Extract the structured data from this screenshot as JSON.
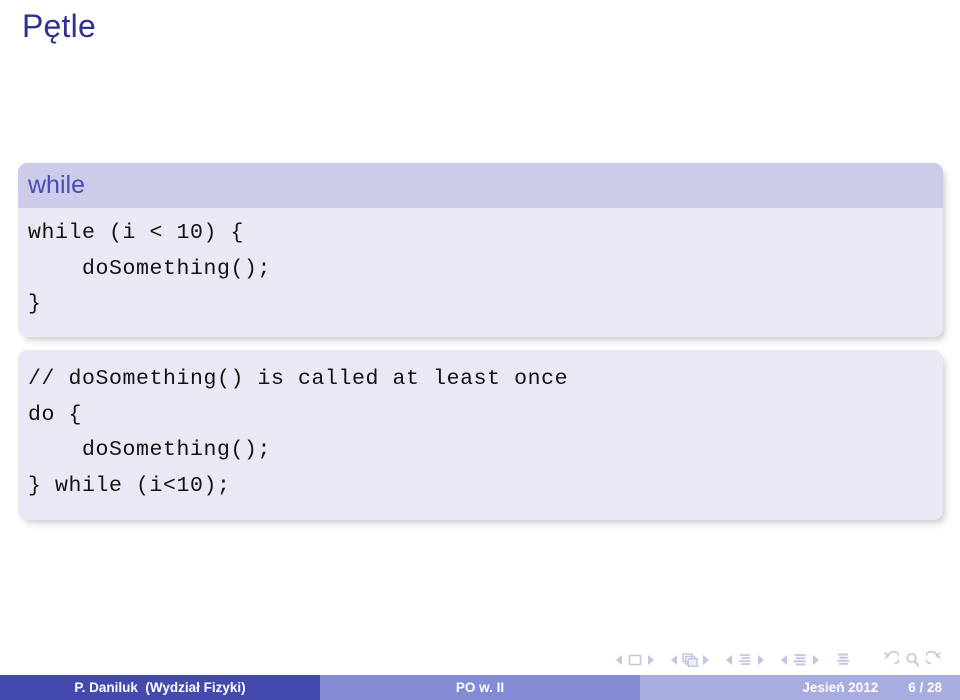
{
  "slide": {
    "title": "Pętle"
  },
  "blocks": [
    {
      "id": "while",
      "title": "while",
      "has_title": true,
      "code_lines": [
        "while (i < 10) {",
        "    doSomething();",
        "}"
      ]
    },
    {
      "id": "dowhile",
      "title": "",
      "has_title": false,
      "code_lines": [
        "// doSomething() is called at least once",
        "do {",
        "    doSomething();",
        "} while (i<10);"
      ]
    }
  ],
  "navigation": {
    "items": [
      {
        "name": "slide",
        "icon": "slide-icon"
      },
      {
        "name": "frame",
        "icon": "frame-icon"
      },
      {
        "name": "subsection",
        "icon": "subsection-icon"
      },
      {
        "name": "section",
        "icon": "section-icon"
      },
      {
        "name": "presentation",
        "icon": "presentation-icon"
      }
    ],
    "arrows": [
      {
        "name": "back",
        "icon": "back-arrow-icon"
      },
      {
        "name": "find",
        "icon": "search-icon"
      },
      {
        "name": "forward",
        "icon": "forward-arrow-icon"
      }
    ]
  },
  "footer": {
    "author": "P. Daniluk  (Wydział Fizyki)",
    "course": "PO w. II",
    "date": "Jesień 2012",
    "page": "6 / 28",
    "colors": {
      "author_bg": "#4349ad",
      "course_bg": "#838bd4",
      "date_bg": "#a8addf",
      "text": "#ffffff"
    }
  },
  "theme": {
    "title_color": "#2e3192",
    "block_title_bg": "#ccccea",
    "block_title_text": "#4a4ab4",
    "block_body_bg": "#e9e9f6",
    "code_color": "#12120f",
    "nav_icon_color": "#c3c6e2"
  }
}
